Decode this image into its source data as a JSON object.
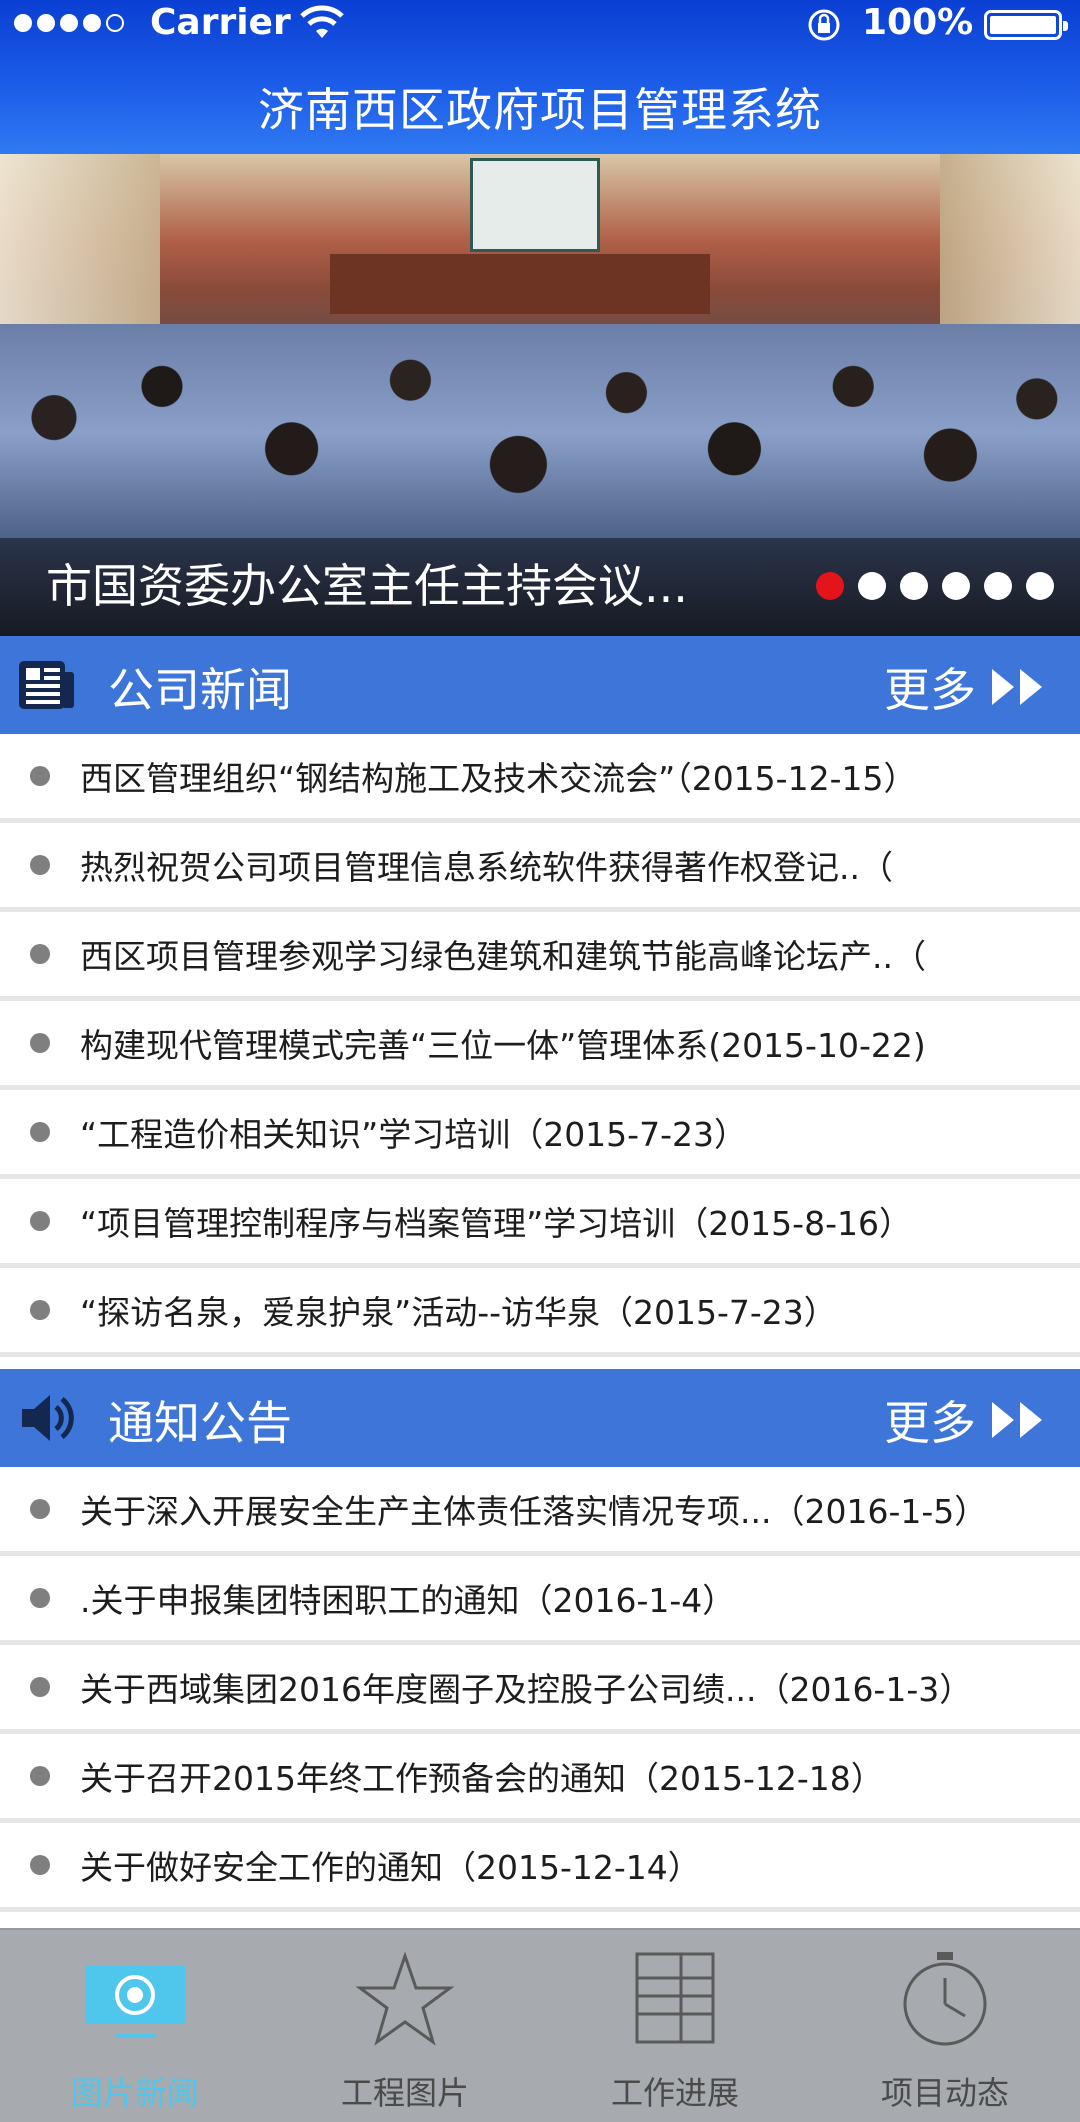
{
  "status_bar": {
    "carrier": "Carrier",
    "battery": "100%"
  },
  "header": {
    "title": "济南西区政府项目管理系统"
  },
  "banner": {
    "caption": "市国资委办公室主任主持会议...",
    "slide_count": 6,
    "active_slide": 1
  },
  "company_news": {
    "title": "公司新闻",
    "more": "更多",
    "items": [
      "西区管理组织“钢结构施工及技术交流会”（2015-12-15）",
      "热烈祝贺公司项目管理信息系统软件获得著作权登记..（",
      "西区项目管理参观学习绿色建筑和建筑节能高峰论坛产..（",
      "构建现代管理模式完善“三位一体”管理体系(2015-10-22)",
      "“工程造价相关知识”学习培训（2015-7-23）",
      "“项目管理控制程序与档案管理”学习培训（2015-8-16）",
      "“探访名泉，爱泉护泉”活动--访华泉（2015-7-23）"
    ]
  },
  "notices": {
    "title": "通知公告",
    "more": "更多",
    "items": [
      "关于深入开展安全生产主体责任落实情况专项...（2016-1-5）",
      ".关于申报集团特困职工的通知（2016-1-4）",
      "关于西域集团2016年度圈子及控股子公司绩...（2016-1-3）",
      "关于召开2015年终工作预备会的通知（2015-12-18）",
      "关于做好安全工作的通知（2015-12-14）"
    ]
  },
  "tabs": [
    {
      "label": "图片新闻",
      "icon": "picture-news-icon",
      "active": true
    },
    {
      "label": "工程图片",
      "icon": "star-icon",
      "active": false
    },
    {
      "label": "工作进展",
      "icon": "list-icon",
      "active": false
    },
    {
      "label": "项目动态",
      "icon": "clock-icon",
      "active": false
    }
  ],
  "colors": {
    "header_blue": "#1c5ce8",
    "section_blue": "#3d75d8",
    "indicator_active": "#e4141b",
    "tab_active": "#4fc6ec",
    "tabbar_bg": "#a7abaf"
  }
}
